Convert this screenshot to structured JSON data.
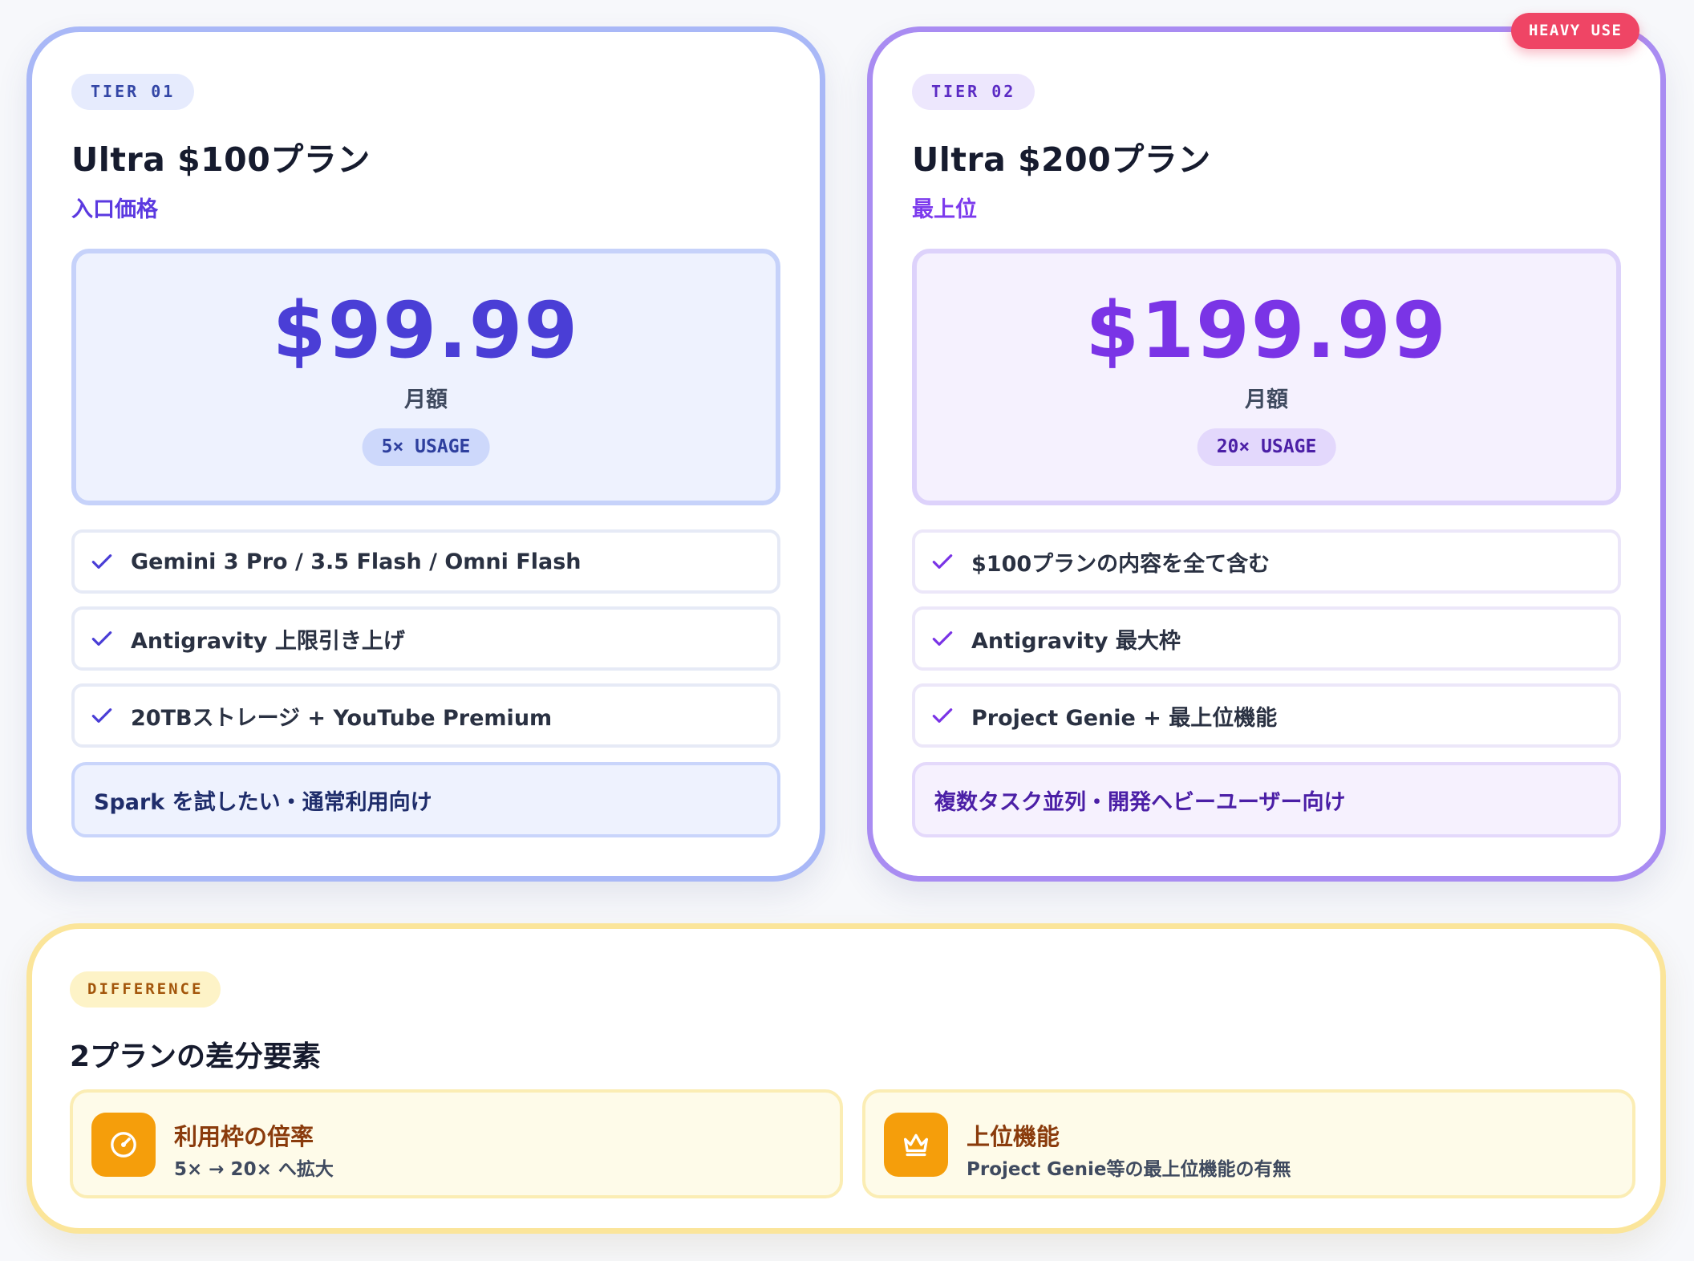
{
  "plans": [
    {
      "tier": "TIER 01",
      "title": "Ultra $100プラン",
      "subtitle": "入口価格",
      "price": "$99.99",
      "period": "月額",
      "usage": "5× USAGE",
      "features": [
        "Gemini 3 Pro / 3.5 Flash / Omni Flash",
        "Antigravity 上限引き上げ",
        "20TBストレージ + YouTube Premium"
      ],
      "target": "Spark を試したい・通常利用向け"
    },
    {
      "tier": "TIER 02",
      "title": "Ultra $200プラン",
      "subtitle": "最上位",
      "price": "$199.99",
      "period": "月額",
      "usage": "20× USAGE",
      "badge": "HEAVY USE",
      "features": [
        "$100プランの内容を全て含む",
        "Antigravity 最大枠",
        "Project Genie + 最上位機能"
      ],
      "target": "複数タスク並列・開発ヘビーユーザー向け"
    }
  ],
  "difference": {
    "tag": "DIFFERENCE",
    "title": "2プランの差分要素",
    "items": [
      {
        "icon": "gauge-icon",
        "heading": "利用枠の倍率",
        "text": "5× → 20× へ拡大"
      },
      {
        "icon": "crown-icon",
        "heading": "上位機能",
        "text": "Project Genie等の最上位機能の有無"
      }
    ]
  },
  "colors": {
    "tier1_accent": "#4a3ed6",
    "tier2_accent": "#7a34e6",
    "heavy_badge": "#ef4565",
    "difference_accent": "#f59e0b"
  }
}
